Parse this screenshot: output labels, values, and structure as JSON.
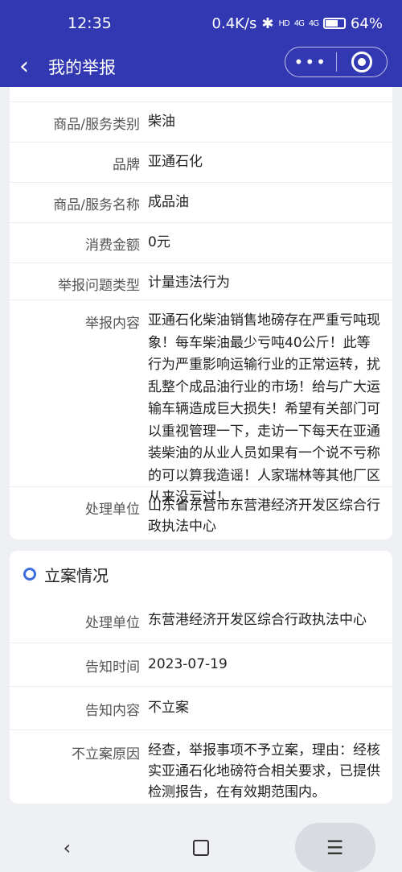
{
  "status_bar": {
    "time": "12:35",
    "net_speed": "0.4K/s",
    "hd_badge": "HD",
    "signal1": "4G",
    "signal2": "4G",
    "battery": "64%",
    "battery_level": 0.64
  },
  "header": {
    "back_icon": "chevron-left-icon",
    "title": "我的举报",
    "more_label": "•••",
    "target_icon": "record-icon"
  },
  "report": {
    "rows": [
      {
        "label": "商品/服务类别",
        "value": "柴油"
      },
      {
        "label": "品牌",
        "value": "亚通石化"
      },
      {
        "label": "商品/服务名称",
        "value": "成品油"
      },
      {
        "label": "消费金额",
        "value": "0元"
      },
      {
        "label": "举报问题类型",
        "value": "计量违法行为"
      },
      {
        "label": "举报内容",
        "value": "亚通石化柴油销售地磅存在严重亏吨现象！每车柴油最少亏吨40公斤！此等行为严重影响运输行业的正常运转，扰乱整个成品油行业的市场！给与广大运输车辆造成巨大损失！希望有关部门可以重视管理一下，走访一下每天在亚通装柴油的从业人员如果有一个说不亏称的可以算我造谣！人家瑞林等其他厂区从来没亏过！"
      },
      {
        "label": "处理单位",
        "value": "山东省东营市东营港经济开发区综合行政执法中心"
      }
    ]
  },
  "filing": {
    "section_title": "立案情况",
    "rows": [
      {
        "label": "处理单位",
        "value": "东营港经济开发区综合行政执法中心"
      },
      {
        "label": "告知时间",
        "value": "2023-07-19"
      },
      {
        "label": "告知内容",
        "value": "不立案"
      },
      {
        "label": "不立案原因",
        "value": "经查，举报事项不予立案，理由：经核实亚通石化地磅符合相关要求，已提供检测报告，在有效期范围内。"
      }
    ]
  },
  "bottom_nav": {
    "back": "‹",
    "home": "",
    "menu": "☰"
  },
  "colors": {
    "header_bg": "#3138b2",
    "accent": "#3d6ee0"
  }
}
